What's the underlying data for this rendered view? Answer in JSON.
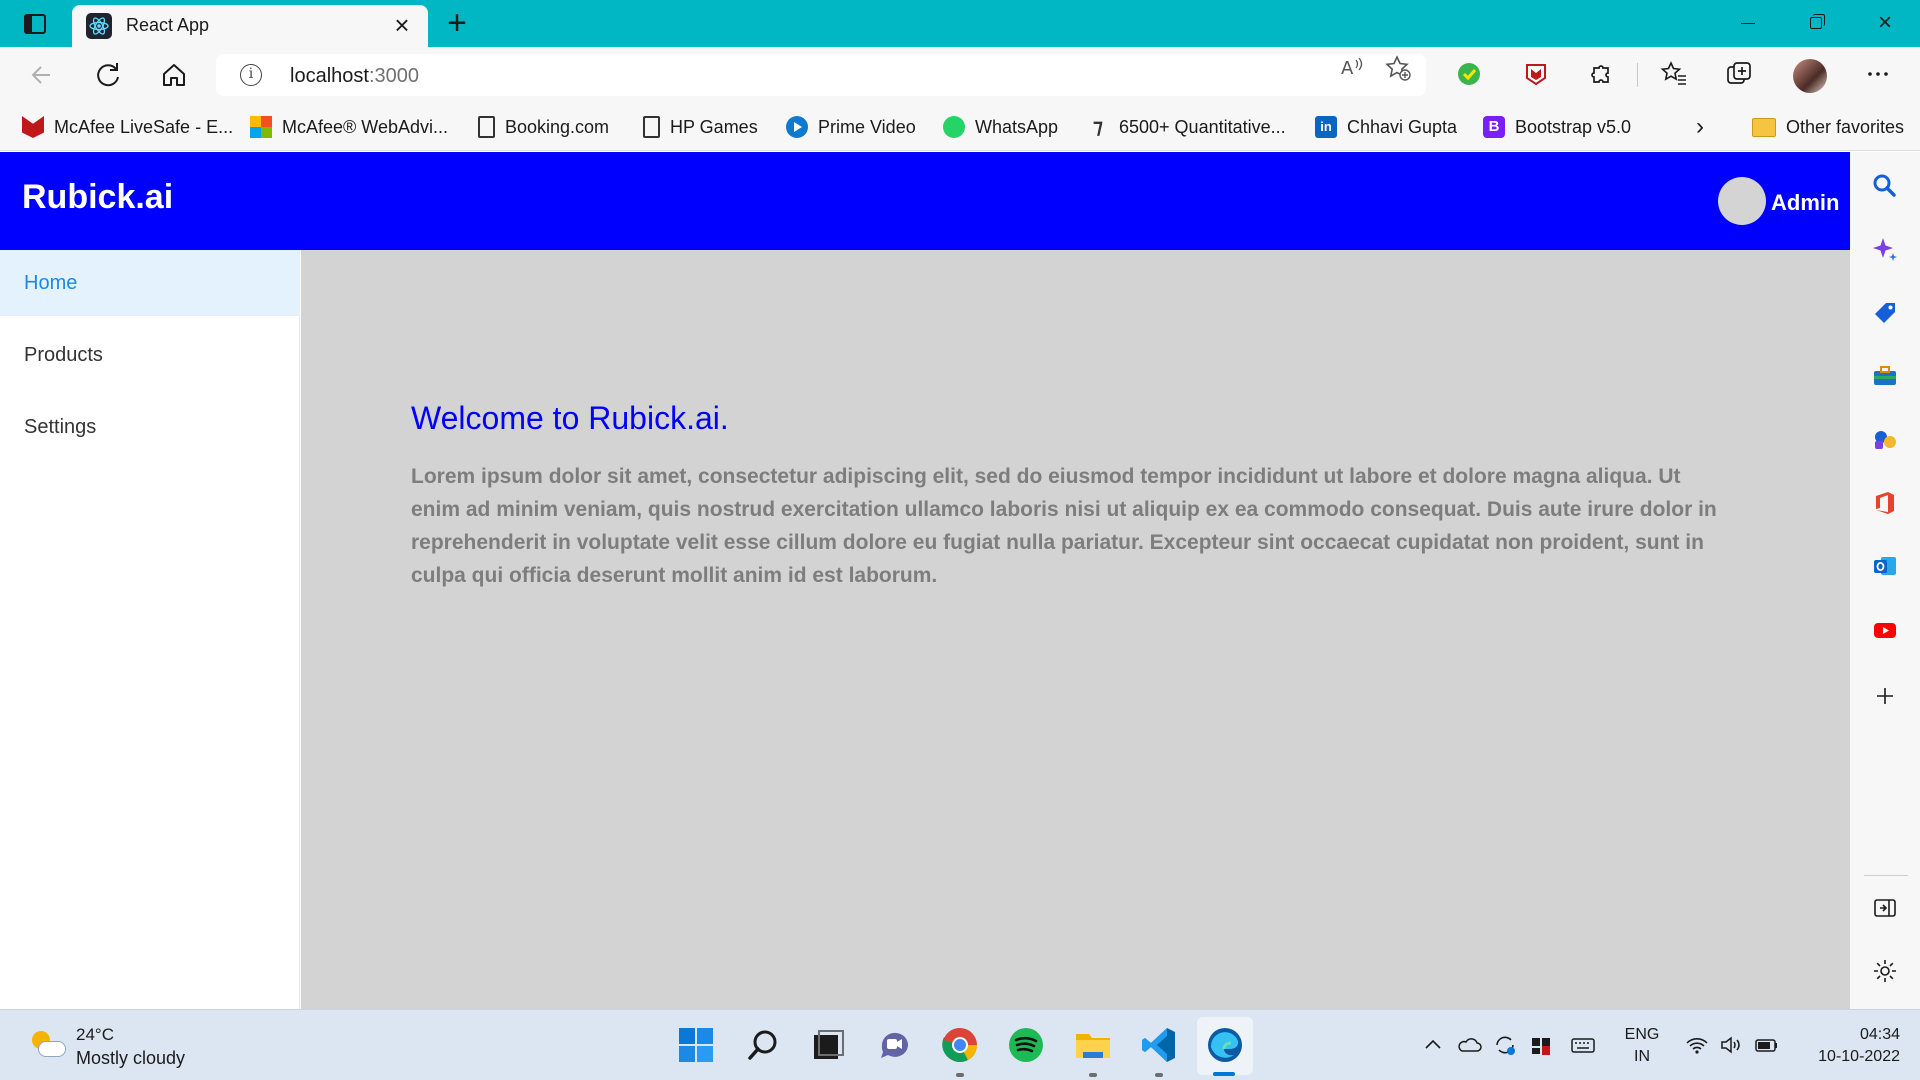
{
  "browser": {
    "tab_title": "React App",
    "close_glyph": "×",
    "new_tab_glyph": "+",
    "address_host": "localhost",
    "address_port": ":3000"
  },
  "favorites": [
    {
      "label": "McAfee LiveSafe - E...",
      "icon": "mcafee-icon"
    },
    {
      "label": "McAfee® WebAdvi...",
      "icon": "microsoft-icon"
    },
    {
      "label": "Booking.com",
      "icon": "page-icon"
    },
    {
      "label": "HP Games",
      "icon": "page-icon"
    },
    {
      "label": "Prime Video",
      "icon": "prime-video-icon"
    },
    {
      "label": "WhatsApp",
      "icon": "whatsapp-icon"
    },
    {
      "label": "6500+ Quantitative...",
      "icon": "quant-icon"
    },
    {
      "label": "Chhavi Gupta",
      "icon": "linkedin-icon"
    },
    {
      "label": "Bootstrap v5.0",
      "icon": "bootstrap-icon"
    },
    {
      "label": "Other favorites",
      "icon": "folder-icon"
    }
  ],
  "app": {
    "brand": "Rubick.ai",
    "user_label": "Admin",
    "nav": [
      {
        "label": "Home",
        "active": true
      },
      {
        "label": "Products",
        "active": false
      },
      {
        "label": "Settings",
        "active": false
      }
    ],
    "welcome_title": "Welcome to Rubick.ai.",
    "body_text": "Lorem ipsum dolor sit amet, consectetur adipiscing elit, sed do eiusmod tempor incididunt ut labore et dolore magna aliqua. Ut enim ad minim veniam, quis nostrud exercitation ullamco laboris nisi ut aliquip ex ea commodo consequat. Duis aute irure dolor in reprehenderit in voluptate velit esse cillum dolore eu fugiat nulla pariatur. Excepteur sint occaecat cupidatat non proident, sunt in culpa qui officia deserunt mollit anim id est laborum."
  },
  "taskbar": {
    "temperature": "24°C",
    "weather": "Mostly cloudy",
    "lang_1": "ENG",
    "lang_2": "IN",
    "time": "04:34",
    "date": "10-10-2022"
  },
  "colors": {
    "titlebar": "#00b7c3",
    "app_header": "#0000ff",
    "main_bg": "#d3d3d3",
    "active_nav_bg": "#e4f2fd",
    "active_nav_text": "#1e88e5"
  }
}
